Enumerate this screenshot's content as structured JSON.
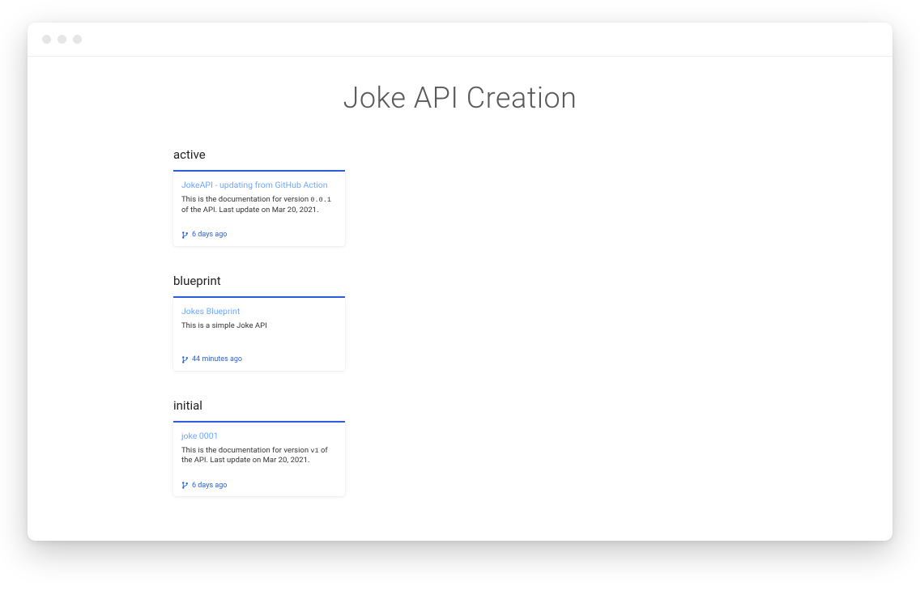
{
  "header": {
    "title": "Joke API Creation"
  },
  "sections": {
    "active": {
      "label": "active",
      "card": {
        "title": "JokeAPI - updating from GitHub Action",
        "desc_pre": "This is the documentation for version ",
        "version": "0.0.1",
        "desc_post": " of the API. Last update on Mar 20, 2021.",
        "time": "6 days ago"
      }
    },
    "blueprint": {
      "label": "blueprint",
      "card": {
        "title": "Jokes Blueprint",
        "desc_pre": "This is a simple Joke API",
        "version": "",
        "desc_post": "",
        "time": "44 minutes ago"
      }
    },
    "initial": {
      "label": "initial",
      "card": {
        "title": "joke 0001",
        "desc_pre": "This is the documentation for version ",
        "version": "v1",
        "desc_post": " of the API. Last update on Mar 20, 2021.",
        "time": "6 days ago"
      }
    }
  }
}
